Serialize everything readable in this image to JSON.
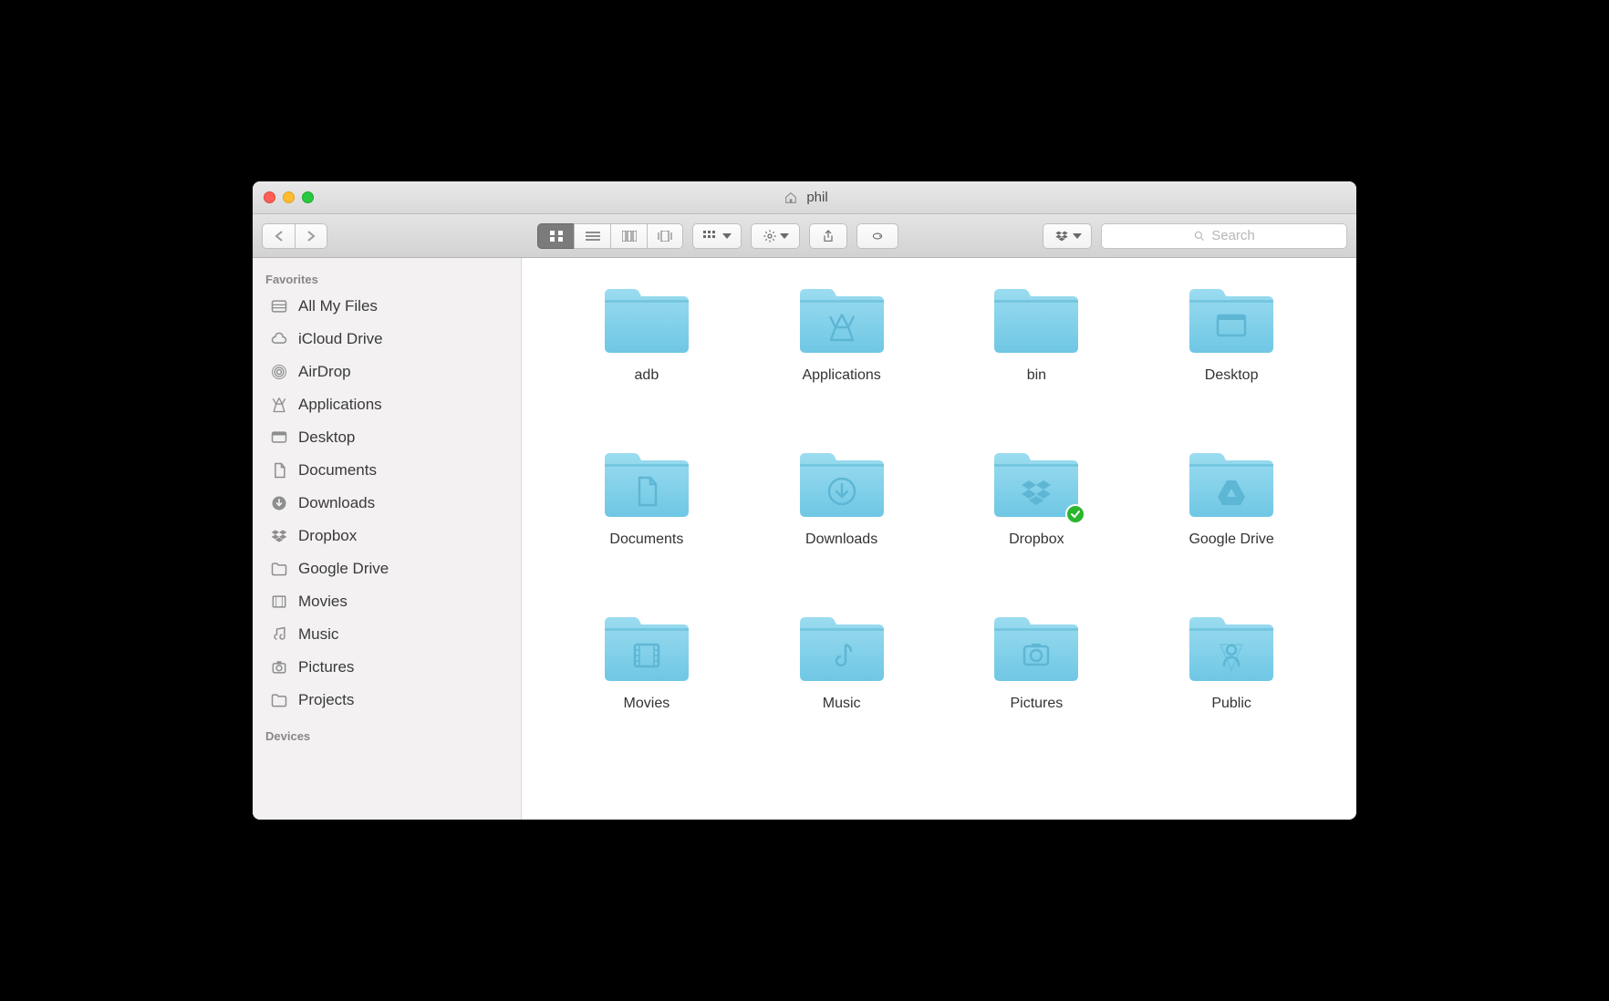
{
  "window": {
    "title": "phil"
  },
  "search": {
    "placeholder": "Search"
  },
  "sidebar": {
    "sections": {
      "favorites": {
        "header": "Favorites",
        "items": [
          {
            "label": "All My Files",
            "icon": "all-my-files"
          },
          {
            "label": "iCloud Drive",
            "icon": "icloud"
          },
          {
            "label": "AirDrop",
            "icon": "airdrop"
          },
          {
            "label": "Applications",
            "icon": "applications"
          },
          {
            "label": "Desktop",
            "icon": "desktop"
          },
          {
            "label": "Documents",
            "icon": "documents"
          },
          {
            "label": "Downloads",
            "icon": "downloads"
          },
          {
            "label": "Dropbox",
            "icon": "dropbox"
          },
          {
            "label": "Google Drive",
            "icon": "folder"
          },
          {
            "label": "Movies",
            "icon": "movies"
          },
          {
            "label": "Music",
            "icon": "music"
          },
          {
            "label": "Pictures",
            "icon": "pictures"
          },
          {
            "label": "Projects",
            "icon": "folder"
          }
        ]
      },
      "devices": {
        "header": "Devices"
      }
    }
  },
  "folders": [
    {
      "name": "adb",
      "glyph": "none"
    },
    {
      "name": "Applications",
      "glyph": "applications"
    },
    {
      "name": "bin",
      "glyph": "none"
    },
    {
      "name": "Desktop",
      "glyph": "desktop"
    },
    {
      "name": "Documents",
      "glyph": "documents"
    },
    {
      "name": "Downloads",
      "glyph": "downloads"
    },
    {
      "name": "Dropbox",
      "glyph": "dropbox",
      "synced": true
    },
    {
      "name": "Google Drive",
      "glyph": "gdrive"
    },
    {
      "name": "Movies",
      "glyph": "movies"
    },
    {
      "name": "Music",
      "glyph": "music"
    },
    {
      "name": "Pictures",
      "glyph": "pictures"
    },
    {
      "name": "Public",
      "glyph": "public"
    }
  ]
}
